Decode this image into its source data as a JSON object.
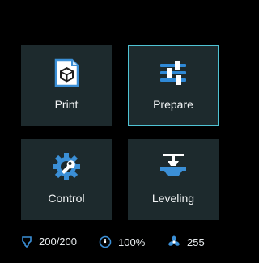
{
  "menu": {
    "print_label": "Print",
    "prepare_label": "Prepare",
    "control_label": "Control",
    "leveling_label": "Leveling",
    "selected": "Prepare"
  },
  "status": {
    "nozzle_temp": "200/200",
    "speed": "100%",
    "fan": "255"
  },
  "icons": {
    "print": "print-file-icon",
    "prepare": "sliders-icon",
    "control": "gear-wrench-icon",
    "leveling": "leveling-icon",
    "nozzle": "nozzle-icon",
    "speed": "speedometer-icon",
    "fan": "fan-icon"
  },
  "colors": {
    "background": "#000000",
    "tile": "#1d2a2d",
    "accent": "#4fc3d4",
    "icon_blue": "#3b8fd6"
  }
}
